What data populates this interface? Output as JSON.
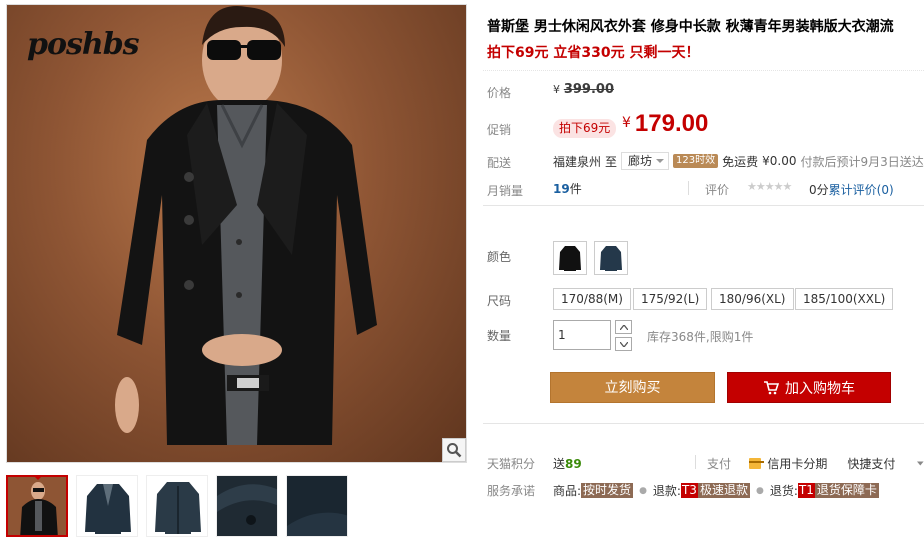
{
  "gallery": {
    "brand_logo": "poshbs",
    "thumbnails": [
      "model-front",
      "jacket-front",
      "jacket-front-alt",
      "collar-detail",
      "fabric-detail"
    ]
  },
  "product": {
    "title": "普斯堡 男士休闲风衣外套 修身中长款 秋薄青年男装韩版大衣潮流",
    "promo_line": "拍下69元 立省330元 只剩一天！"
  },
  "price": {
    "orig_label": "价格",
    "currency": "¥",
    "orig_value": "399.00",
    "promo_label": "促销",
    "promo_tag": "拍下69元",
    "promo_value": "179.00"
  },
  "shipping": {
    "label": "配送",
    "from": "福建泉州",
    "to_word": "至",
    "city": "廊坊",
    "badge": "123时效",
    "free": "免运费",
    "fee": "¥0.00",
    "note": "付款后预计9月3日送达"
  },
  "sales": {
    "label": "月销量",
    "count": "19",
    "unit": "件",
    "rate_label": "评价",
    "stars": "★★★★★",
    "rate_score": "0分",
    "rate_link": "累计评价(0)"
  },
  "sku": {
    "color_label": "颜色",
    "size_label": "尺码",
    "sizes": [
      "170/88(M)",
      "175/92(L)",
      "180/96(XL)",
      "185/100(XXL)"
    ],
    "qty_label": "数量",
    "qty_value": "1",
    "stock": "库存368件,限购1件"
  },
  "actions": {
    "buy": "立刻购买",
    "cart": "加入购物车"
  },
  "extras": {
    "points_label": "天猫积分",
    "points_prefix": "送",
    "points_value": "89",
    "pay_label": "支付",
    "credit": "信用卡分期",
    "quick_pay": "快捷支付",
    "service_label": "服务承诺",
    "svc1_prefix": "商品:",
    "svc1_tag": "按时发货",
    "svc2_prefix": "退款:",
    "svc2_code": "T3",
    "svc2_tag": "极速退款",
    "svc3_prefix": "退货:",
    "svc3_code": "T1",
    "svc3_tag": "退货保障卡"
  },
  "colors": {
    "accent_red": "#c40000",
    "buy_orange": "#c4843c",
    "link_blue": "#1a5fa0",
    "points_green": "#3b8a0a"
  }
}
